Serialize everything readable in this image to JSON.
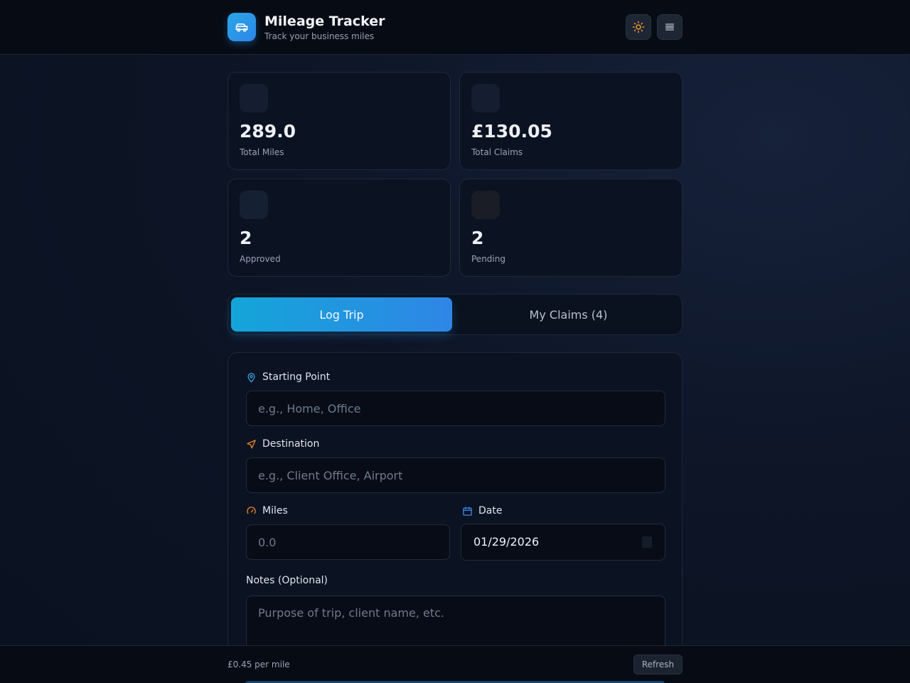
{
  "header": {
    "title": "Mileage Tracker",
    "subtitle": "Track your business miles",
    "logo_icon": "car-icon",
    "theme_icon": "sun-icon",
    "menu_icon": "menu-icon",
    "accent": "#2a9ee6"
  },
  "stats": [
    {
      "value": "289.0",
      "label": "Total Miles"
    },
    {
      "value": "£130.05",
      "label": "Total Claims"
    },
    {
      "value": "2",
      "label": "Approved"
    },
    {
      "value": "2",
      "label": "Pending"
    }
  ],
  "tabs": {
    "log_trip": "Log Trip",
    "my_claims": "My Claims (4)",
    "active": "log_trip"
  },
  "form": {
    "start": {
      "label": "Starting Point",
      "placeholder": "e.g., Home, Office",
      "icon": "map-pin-icon"
    },
    "destination": {
      "label": "Destination",
      "placeholder": "e.g., Client Office, Airport",
      "icon": "navigation-icon"
    },
    "miles": {
      "label": "Miles",
      "placeholder": "0.0",
      "icon": "speedometer-icon"
    },
    "date": {
      "label": "Date",
      "value": "01/29/2026",
      "icon": "calendar-icon"
    },
    "notes": {
      "label": "Notes (Optional)",
      "placeholder": "Purpose of trip, client name, etc."
    }
  },
  "footer": {
    "rate": "£0.45 per mile",
    "refresh": "Refresh"
  }
}
